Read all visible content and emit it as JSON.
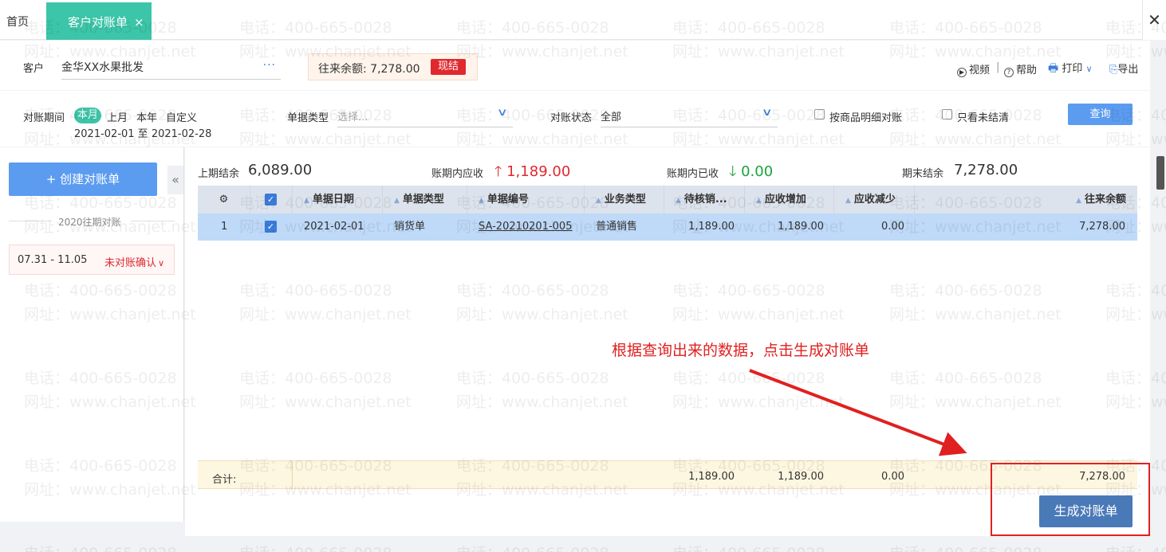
{
  "tabs": {
    "home": "首页",
    "active": "客户对账单",
    "close_glyph": "×"
  },
  "window": {
    "close_glyph": "✕"
  },
  "header": {
    "customer_label": "客户",
    "customer_value": "金华XX水果批发",
    "more_glyph": "···",
    "balance_text": "往来余额: 7,278.00",
    "settled_badge": "现结",
    "tools": {
      "video": "视频",
      "help": "帮助",
      "print": "打印",
      "export": "导出",
      "sep": "|"
    }
  },
  "filter": {
    "period_label": "对账期间",
    "period_options": [
      "本月",
      "上月",
      "本年",
      "自定义"
    ],
    "date_range": "2021-02-01 至 2021-02-28",
    "billtype_label": "单据类型",
    "billtype_placeholder": "选择...",
    "status_label": "对账状态",
    "status_value": "全部",
    "by_goods_label": "按商品明细对账",
    "only_open_label": "只看未结清",
    "query_button": "查询"
  },
  "left": {
    "create_button": "+ 创建对账单",
    "collapse_glyph": "«",
    "year_label": "2020往期对账",
    "period_range": "07.31 - 11.05",
    "period_status": "未对账确认"
  },
  "summary": {
    "opening_label": "上期结余",
    "opening_value": "6,089.00",
    "receivable_label": "账期内应收",
    "receivable_value": "1,189.00",
    "received_label": "账期内已收",
    "received_value": "0.00",
    "closing_label": "期末结余",
    "closing_value": "7,278.00"
  },
  "table": {
    "columns": [
      "单据日期",
      "单据类型",
      "单据编号",
      "业务类型",
      "待核销...",
      "应收增加",
      "应收减少",
      "往来余额"
    ],
    "rows": [
      {
        "index": "1",
        "date": "2021-02-01",
        "type": "销货单",
        "number": "SA-20210201-005",
        "biz": "普通销售",
        "pending": "1,189.00",
        "increase": "1,189.00",
        "decrease": "0.00",
        "balance": "7,278.00"
      }
    ],
    "footer": {
      "label": "合计:",
      "pending": "1,189.00",
      "increase": "1,189.00",
      "decrease": "0.00",
      "balance": "7,278.00"
    }
  },
  "generate_button": "生成对账单",
  "annotation": "根据查询出来的数据，点击生成对账单",
  "watermark": {
    "phone": "电话：400-665-0028",
    "site": "网址：www.chanjet.net"
  },
  "colors": {
    "accent": "#3cc5a8",
    "primary": "#5b9cf0",
    "danger": "#e0282e",
    "success": "#1aa33a"
  }
}
